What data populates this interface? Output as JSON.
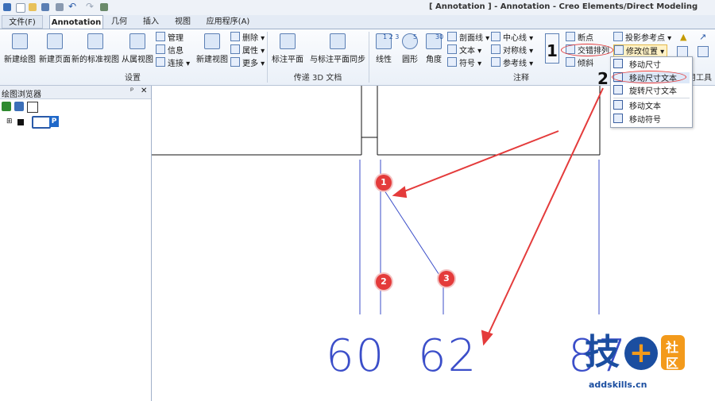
{
  "window": {
    "title": "[ Annotation ] - Annotation - Creo Elements/Direct Modeling"
  },
  "tabs": [
    {
      "label": "文件(F)"
    },
    {
      "label": "Annotation"
    },
    {
      "label": "几何"
    },
    {
      "label": "插入"
    },
    {
      "label": "视图"
    },
    {
      "label": "应用程序(A)"
    }
  ],
  "ribbon": {
    "groups": {
      "setup": "设置",
      "transfer": "传递 3D 文档",
      "annotate": "注释",
      "tools": "用工具"
    },
    "setup": {
      "new_drawing": "新建绘图",
      "new_page": "新建页面",
      "new_std_view": "新的标准视图",
      "from_view": "从属视图",
      "manage": "管理",
      "info": "信息",
      "connect": "连接",
      "new_view": "新建视图",
      "delete": "删除",
      "properties": "属性",
      "more": "更多"
    },
    "transfer": {
      "label_plane": "标注平面",
      "sync_label_plane": "与标注平面同步"
    },
    "annotate": {
      "linear": "线性",
      "circle": "圆形",
      "angle": "角度",
      "section_line": "剖面线",
      "text": "文本",
      "symbol": "符号",
      "center_line": "中心线",
      "symmetry_line": "对称线",
      "ref_line": "参考线",
      "breakpoint": "断点",
      "stagger": "交错排列",
      "tilt": "倾斜",
      "proj_ref_point": "投影参考点",
      "modify_position": "修改位置"
    },
    "angle_sup": "30",
    "circle_sup": "5",
    "linear_sup": "1 2 3"
  },
  "dropdown": {
    "items": [
      {
        "label": "移动尺寸"
      },
      {
        "label": "移动尺寸文本"
      },
      {
        "label": "旋转尺寸文本"
      },
      {
        "label": "移动文本"
      },
      {
        "label": "移动符号"
      }
    ]
  },
  "browser": {
    "title": "绘图浏览器",
    "pin": "ᵖ",
    "close": "✕",
    "node_badge": "P"
  },
  "canvas": {
    "dimensions": [
      "60",
      "62",
      "87"
    ],
    "badges": [
      "1",
      "2",
      "3"
    ],
    "step_labels": [
      "1",
      "2"
    ]
  },
  "logo": {
    "char": "技",
    "plus": "+",
    "side_top": "社",
    "side_bottom": "区",
    "url": "addskills.cn"
  },
  "colors": {
    "accent": "#3b4ec9",
    "arrow": "#e43b3b",
    "logo_blue": "#1b4ea0",
    "logo_orange": "#f39a1b"
  }
}
